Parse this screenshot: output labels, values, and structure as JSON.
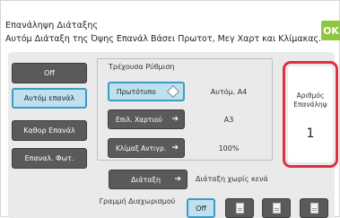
{
  "header": {
    "title": "Επανάληψη Διάταξης",
    "description": "Αυτόμ Διάταξη της Όψης Επανάλ Βάσει Πρωτοτ, Μεγ Χαρτ και Κλίμακας.",
    "ok_label": "OK"
  },
  "mode_buttons": [
    {
      "label": "Off",
      "selected": false
    },
    {
      "label": "Αυτόμ επανάλ",
      "selected": true
    },
    {
      "label": "Καθορ Επανάλ",
      "selected": false
    },
    {
      "label": "Επαναλ. Φωτ.",
      "selected": false
    }
  ],
  "current_settings": {
    "title": "Τρέχουσα Ρύθμιση",
    "rows": [
      {
        "button": "Πρωτότυπο",
        "value": "Αυτόμ.   A4",
        "icon": "diamond-icon"
      },
      {
        "button": "Επιλ. Χαρτιού",
        "value": "A3",
        "icon": "arrow-right-icon"
      },
      {
        "button": "Κλίμαξ Αντιγρ.",
        "value": "100%",
        "icon": "arrow-right-icon"
      }
    ]
  },
  "repeat_count": {
    "label": "Αριθμός Επανάληψ",
    "value": "1"
  },
  "layout": {
    "button": "Διάταξη",
    "value": "Διάταξη χωρίς κενά"
  },
  "separation_line": {
    "label": "Γραμμή Διαχωρισμού",
    "off_label": "Off"
  },
  "colors": {
    "accent": "#3d9bc5",
    "ok_green": "#8fc63f",
    "highlight_red": "#e03040"
  }
}
